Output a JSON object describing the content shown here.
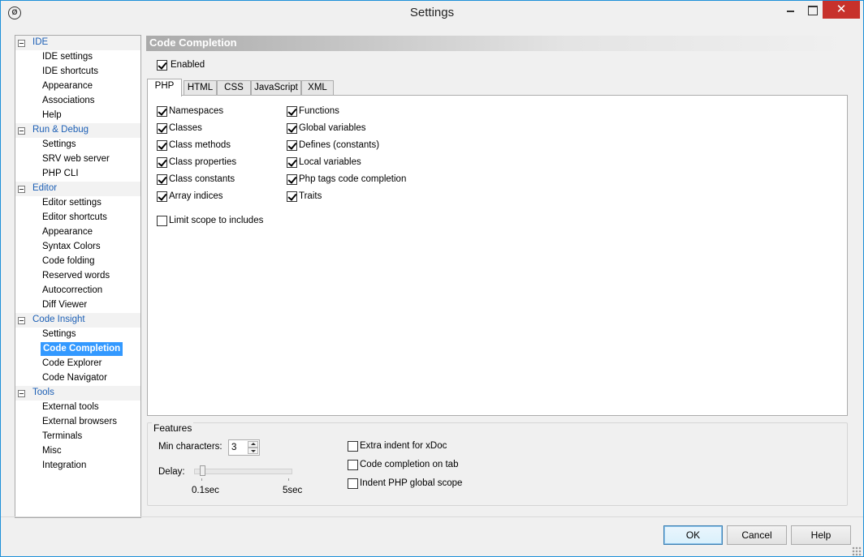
{
  "window": {
    "title": "Settings",
    "close_glyph": "✕",
    "app_icon_glyph": "Ø"
  },
  "tree": [
    {
      "label": "IDE",
      "items": [
        "IDE settings",
        "IDE shortcuts",
        "Appearance",
        "Associations",
        "Help"
      ]
    },
    {
      "label": "Run & Debug",
      "items": [
        "Settings",
        "SRV web server",
        "PHP CLI"
      ]
    },
    {
      "label": "Editor",
      "items": [
        "Editor settings",
        "Editor shortcuts",
        "Appearance",
        "Syntax Colors",
        "Code folding",
        "Reserved words",
        "Autocorrection",
        "Diff Viewer"
      ]
    },
    {
      "label": "Code Insight",
      "items": [
        "Settings",
        "Code Completion",
        "Code Explorer",
        "Code Navigator"
      ]
    },
    {
      "label": "Tools",
      "items": [
        "External tools",
        "External browsers",
        "Terminals",
        "Misc",
        "Integration"
      ]
    }
  ],
  "selected_item": "Code Completion",
  "section_title": "Code Completion",
  "enabled": {
    "label": "Enabled",
    "checked": true
  },
  "tabs": [
    "PHP",
    "HTML",
    "CSS",
    "JavaScript",
    "XML"
  ],
  "active_tab": "PHP",
  "php_options_left": [
    {
      "label": "Namespaces",
      "checked": true
    },
    {
      "label": "Classes",
      "checked": true
    },
    {
      "label": "Class methods",
      "checked": true
    },
    {
      "label": "Class properties",
      "checked": true
    },
    {
      "label": "Class constants",
      "checked": true
    },
    {
      "label": "Array indices",
      "checked": true
    }
  ],
  "php_options_right": [
    {
      "label": "Functions",
      "checked": true
    },
    {
      "label": "Global variables",
      "checked": true
    },
    {
      "label": "Defines (constants)",
      "checked": true
    },
    {
      "label": "Local variables",
      "checked": true
    },
    {
      "label": "Php tags code completion",
      "checked": true
    },
    {
      "label": "Traits",
      "checked": true
    }
  ],
  "limit_scope": {
    "label": "Limit scope to includes",
    "checked": false
  },
  "features": {
    "legend": "Features",
    "min_chars_label": "Min characters:",
    "min_chars_value": "3",
    "delay_label": "Delay:",
    "delay_min_label": "0.1sec",
    "delay_max_label": "5sec",
    "delay_level_fraction": 0.0,
    "options": [
      {
        "label": "Extra indent for xDoc",
        "checked": false
      },
      {
        "label": "Code completion on tab",
        "checked": false
      },
      {
        "label": "Indent PHP global scope",
        "checked": false
      }
    ]
  },
  "buttons": {
    "ok": "OK",
    "cancel": "Cancel",
    "help": "Help"
  }
}
